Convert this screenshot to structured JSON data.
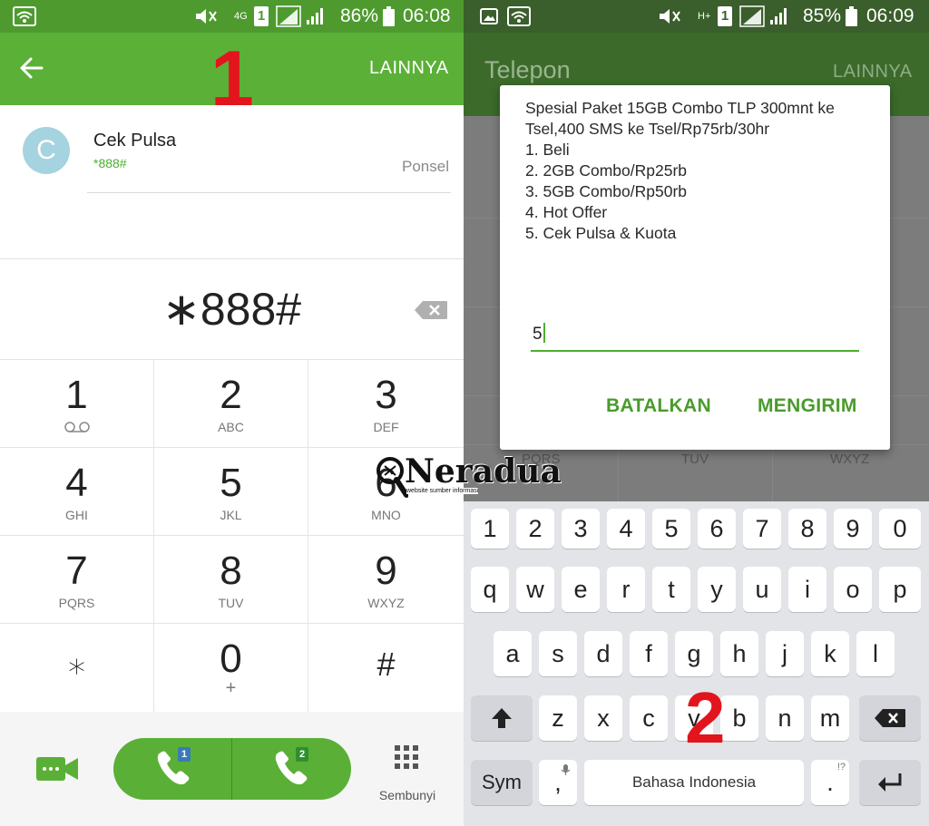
{
  "left": {
    "status": {
      "network": "4G",
      "sim": "1",
      "battery": "86%",
      "time": "06:08"
    },
    "header": {
      "more_label": "LAINNYA",
      "step_number": "1"
    },
    "contact": {
      "initial": "C",
      "name": "Cek Pulsa",
      "number": "*888#",
      "type": "Ponsel"
    },
    "dial_display": "∗888#",
    "keypad": [
      {
        "digit": "1",
        "sub": ""
      },
      {
        "digit": "2",
        "sub": "ABC"
      },
      {
        "digit": "3",
        "sub": "DEF"
      },
      {
        "digit": "4",
        "sub": "GHI"
      },
      {
        "digit": "5",
        "sub": "JKL"
      },
      {
        "digit": "6",
        "sub": "MNO"
      },
      {
        "digit": "7",
        "sub": "PQRS"
      },
      {
        "digit": "8",
        "sub": "TUV"
      },
      {
        "digit": "9",
        "sub": "WXYZ"
      },
      {
        "digit": "∗",
        "sub": ""
      },
      {
        "digit": "0",
        "sub": "+"
      },
      {
        "digit": "#",
        "sub": ""
      }
    ],
    "bottom": {
      "sim1_badge": "1",
      "sim2_badge": "2",
      "hide_label": "Sembunyi"
    }
  },
  "right": {
    "status": {
      "network": "H+",
      "sim": "1",
      "battery": "85%",
      "time": "06:09"
    },
    "header": {
      "title": "Telepon",
      "more_label": "LAINNYA",
      "step_number": "2"
    },
    "behind": {
      "col1": "PQRS",
      "col2": "TUV",
      "col3": "WXYZ"
    },
    "dialog": {
      "message_lines": [
        "Spesial Paket 15GB Combo TLP 300mnt ke",
        "Tsel,400 SMS ke Tsel/Rp75rb/30hr",
        "1. Beli",
        "2. 2GB Combo/Rp25rb",
        "3. 5GB Combo/Rp50rb",
        "4. Hot Offer",
        "5. Cek Pulsa & Kuota"
      ],
      "input_value": "5",
      "cancel_label": "BATALKAN",
      "send_label": "MENGIRIM"
    },
    "keyboard": {
      "row_numbers": [
        "1",
        "2",
        "3",
        "4",
        "5",
        "6",
        "7",
        "8",
        "9",
        "0"
      ],
      "row1": [
        "q",
        "w",
        "e",
        "r",
        "t",
        "y",
        "u",
        "i",
        "o",
        "p"
      ],
      "row2": [
        "a",
        "s",
        "d",
        "f",
        "g",
        "h",
        "j",
        "k",
        "l"
      ],
      "row3": [
        "z",
        "x",
        "c",
        "v",
        "b",
        "n",
        "m"
      ],
      "sym_label": "Sym",
      "comma_label": ",",
      "space_label": "Bahasa Indonesia",
      "period_label": ".",
      "period_hint": "!?"
    }
  },
  "watermark": {
    "brand": "Neradua",
    "tagline": "website sumber informasi"
  },
  "colors": {
    "green": "#5bb037",
    "green_dark": "#4e9a2f",
    "accent_text": "#4caf2e",
    "step_red": "#e2151d"
  }
}
